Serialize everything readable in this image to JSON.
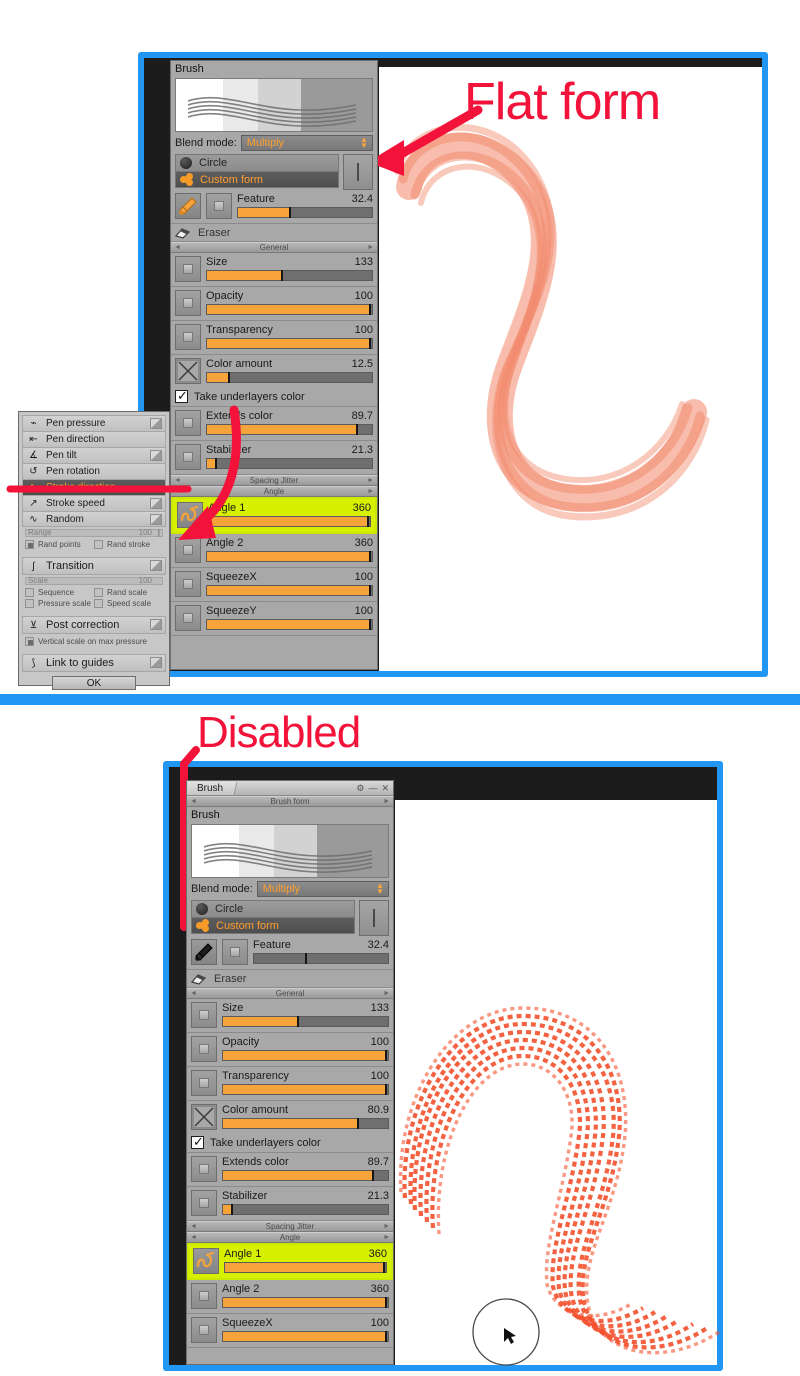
{
  "annotations": {
    "top_label": "Flat form",
    "bottom_label": "Disabled",
    "color": "#f2123a"
  },
  "top_panel": {
    "header_label": "Brush",
    "blend": {
      "label": "Blend mode:",
      "value": "Multiply"
    },
    "forms": [
      {
        "label": "Circle",
        "icon": "circle-icon",
        "selected": false
      },
      {
        "label": "Custom form",
        "icon": "flower-icon",
        "selected": true
      }
    ],
    "feature": {
      "label": "Feature",
      "value": "32.4",
      "fill_pct": 38,
      "icon": "brush-icon",
      "enabled": true
    },
    "eraser": {
      "label": "Eraser",
      "icon": "eraser-icon"
    },
    "sections": {
      "general": "General",
      "spacing_jitter": "Spacing Jitter",
      "angle": "Angle"
    },
    "sliders": [
      {
        "label": "Size",
        "value": "133",
        "fill_pct": 45,
        "icon": "square-icon"
      },
      {
        "label": "Opacity",
        "value": "100",
        "fill_pct": 100,
        "icon": "square-icon"
      },
      {
        "label": "Transparency",
        "value": "100",
        "fill_pct": 100,
        "icon": "square-icon"
      },
      {
        "label": "Color amount",
        "value": "12.5",
        "fill_pct": 13,
        "icon": "x-icon"
      },
      {
        "label": "Extends color",
        "value": "89.7",
        "fill_pct": 90,
        "icon": "square-icon"
      },
      {
        "label": "Stabilizer",
        "value": "21.3",
        "fill_pct": 5,
        "icon": "square-icon"
      }
    ],
    "checkbox": {
      "label": "Take underlayers color",
      "checked": true
    },
    "angle_sliders": [
      {
        "label": "Angle 1",
        "value": "360",
        "fill_pct": 100,
        "icon": "squiggle-icon",
        "highlighted": true
      },
      {
        "label": "Angle 2",
        "value": "360",
        "fill_pct": 100,
        "icon": "square-icon",
        "highlighted": false
      },
      {
        "label": "SqueezeX",
        "value": "100",
        "fill_pct": 100,
        "icon": "square-icon",
        "highlighted": false
      },
      {
        "label": "SqueezeY",
        "value": "100",
        "fill_pct": 100,
        "icon": "square-icon",
        "highlighted": false
      }
    ]
  },
  "bottom_panel": {
    "title_tab": "Brush",
    "titlebar_icons": [
      "gear-icon",
      "minimize-icon",
      "close-icon"
    ],
    "brush_form_section": "Brush form",
    "header_label": "Brush",
    "blend": {
      "label": "Blend mode:",
      "value": "Multiply"
    },
    "forms": [
      {
        "label": "Circle",
        "icon": "circle-icon",
        "selected": false
      },
      {
        "label": "Custom form",
        "icon": "flower-icon",
        "selected": true
      }
    ],
    "feature": {
      "label": "Feature",
      "value": "32.4",
      "fill_pct": 38,
      "icon": "brush-icon",
      "enabled": false
    },
    "eraser": {
      "label": "Eraser",
      "icon": "eraser-icon"
    },
    "sections": {
      "general": "General",
      "spacing_jitter": "Spacing Jitter",
      "angle": "Angle"
    },
    "sliders": [
      {
        "label": "Size",
        "value": "133",
        "fill_pct": 45,
        "icon": "square-icon"
      },
      {
        "label": "Opacity",
        "value": "100",
        "fill_pct": 100,
        "icon": "square-icon"
      },
      {
        "label": "Transparency",
        "value": "100",
        "fill_pct": 100,
        "icon": "square-icon"
      },
      {
        "label": "Color amount",
        "value": "80.9",
        "fill_pct": 81,
        "icon": "x-icon"
      },
      {
        "label": "Extends color",
        "value": "89.7",
        "fill_pct": 90,
        "icon": "square-icon"
      },
      {
        "label": "Stabilizer",
        "value": "21.3",
        "fill_pct": 5,
        "icon": "square-icon"
      }
    ],
    "checkbox": {
      "label": "Take underlayers color",
      "checked": true
    },
    "angle_sliders": [
      {
        "label": "Angle 1",
        "value": "360",
        "fill_pct": 100,
        "icon": "squiggle-icon",
        "highlighted": true
      },
      {
        "label": "Angle 2",
        "value": "360",
        "fill_pct": 100,
        "icon": "square-icon",
        "highlighted": false
      },
      {
        "label": "SqueezeX",
        "value": "100",
        "fill_pct": 100,
        "icon": "square-icon",
        "highlighted": false
      }
    ]
  },
  "pen_dialog": {
    "items": [
      {
        "label": "Pen pressure",
        "icon": "pen-pressure-icon",
        "toggle": true,
        "selected": false
      },
      {
        "label": "Pen direction",
        "icon": "pen-direction-icon",
        "toggle": false,
        "selected": false
      },
      {
        "label": "Pen tilt",
        "icon": "pen-tilt-icon",
        "toggle": true,
        "selected": false
      },
      {
        "label": "Pen rotation",
        "icon": "pen-rotation-icon",
        "toggle": false,
        "selected": false
      },
      {
        "label": "Stroke direction",
        "icon": "stroke-direction-icon",
        "toggle": false,
        "selected": true
      },
      {
        "label": "Stroke speed",
        "icon": "stroke-speed-icon",
        "toggle": true,
        "selected": false
      },
      {
        "label": "Random",
        "icon": "random-icon",
        "toggle": true,
        "selected": false
      }
    ],
    "random_sub": {
      "track_label": "Range",
      "track_value": "100",
      "checks": [
        {
          "label": "Rand points",
          "checked": true
        },
        {
          "label": "Rand stroke",
          "checked": false
        }
      ]
    },
    "transition": {
      "label": "Transition",
      "icon": "transition-icon",
      "toggle": true
    },
    "transition_sub": {
      "track_label": "Scale",
      "track_value": "100",
      "checks": [
        {
          "label": "Sequence",
          "checked": false
        },
        {
          "label": "Rand scale",
          "checked": false
        },
        {
          "label": "Pressure scale",
          "checked": false
        },
        {
          "label": "Speed scale",
          "checked": false
        }
      ]
    },
    "post_correction": {
      "label": "Post correction",
      "icon": "post-correction-icon",
      "toggle": true
    },
    "post_sub": {
      "checks": [
        {
          "label": "Vertical scale on max pressure",
          "checked": true
        }
      ]
    },
    "link_to_guides": {
      "label": "Link to guides",
      "icon": "link-guides-icon",
      "toggle": true
    },
    "ok_button": "OK"
  },
  "canvas": {
    "top_stroke": "smooth-ribbon-s-curve",
    "bottom_stroke": "dashed-hatched-s-curve",
    "stroke_color": "#f4673f",
    "cursor": "brush-circle-cursor"
  }
}
